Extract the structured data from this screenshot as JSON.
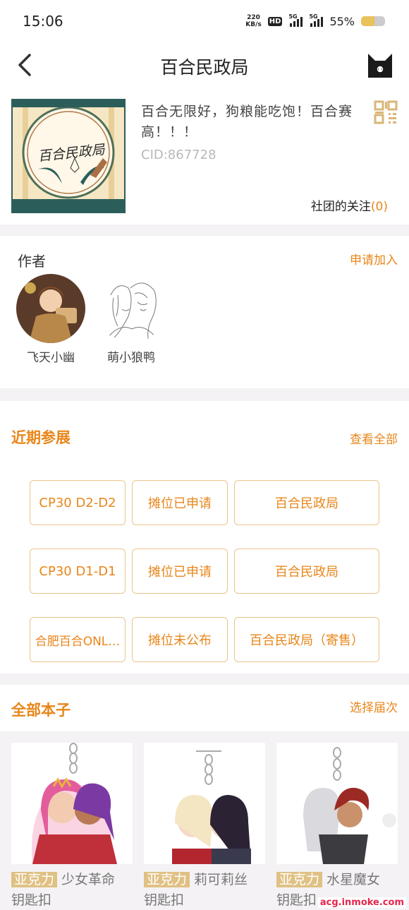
{
  "status_bar": {
    "time": "15:06",
    "net_speed": "220",
    "net_unit": "KB/s",
    "hd_label": "HD",
    "signal1_label": "5G",
    "signal2_label": "5G",
    "battery_text": "55%",
    "battery_level": 0.55
  },
  "nav": {
    "title": "百合民政局"
  },
  "club": {
    "logo_text": "百合民政局",
    "description": "百合无限好，狗粮能吃饱！百合赛高！！！",
    "cid": "CID:867728",
    "follow_label": "社团的关注",
    "follow_count": "(0)"
  },
  "authors": {
    "section_label": "作者",
    "apply_label": "申请加入",
    "items": [
      {
        "name": "飞天小幽"
      },
      {
        "name": "萌小狼鸭"
      }
    ]
  },
  "events": {
    "section_title": "近期参展",
    "see_all_label": "查看全部",
    "rows": [
      {
        "event": "CP30 D2-D2",
        "status": "摊位已申请",
        "circle": "百合民政局"
      },
      {
        "event": "CP30 D1-D1",
        "status": "摊位已申请",
        "circle": "百合民政局"
      },
      {
        "event": "合肥百合ONL…",
        "status": "摊位未公布",
        "circle": "百合民政局（寄售）"
      }
    ]
  },
  "books": {
    "section_title": "全部本子",
    "select_label": "选择届次",
    "items": [
      {
        "tag": "亚克力",
        "title_line1": "少女革命",
        "title_line2": "钥匙扣"
      },
      {
        "tag": "亚克力",
        "title_line1": "莉可莉丝",
        "title_line2": "钥匙扣"
      },
      {
        "tag": "亚克力",
        "title_line1": "水星魔女",
        "title_line2": "钥匙扣"
      }
    ]
  },
  "watermark": "acg.inmoke.com",
  "colors": {
    "accent": "#e8861a",
    "tag_bg": "#e0c184",
    "event_border": "#ebc48a",
    "page_bg": "#f4f2f4"
  }
}
